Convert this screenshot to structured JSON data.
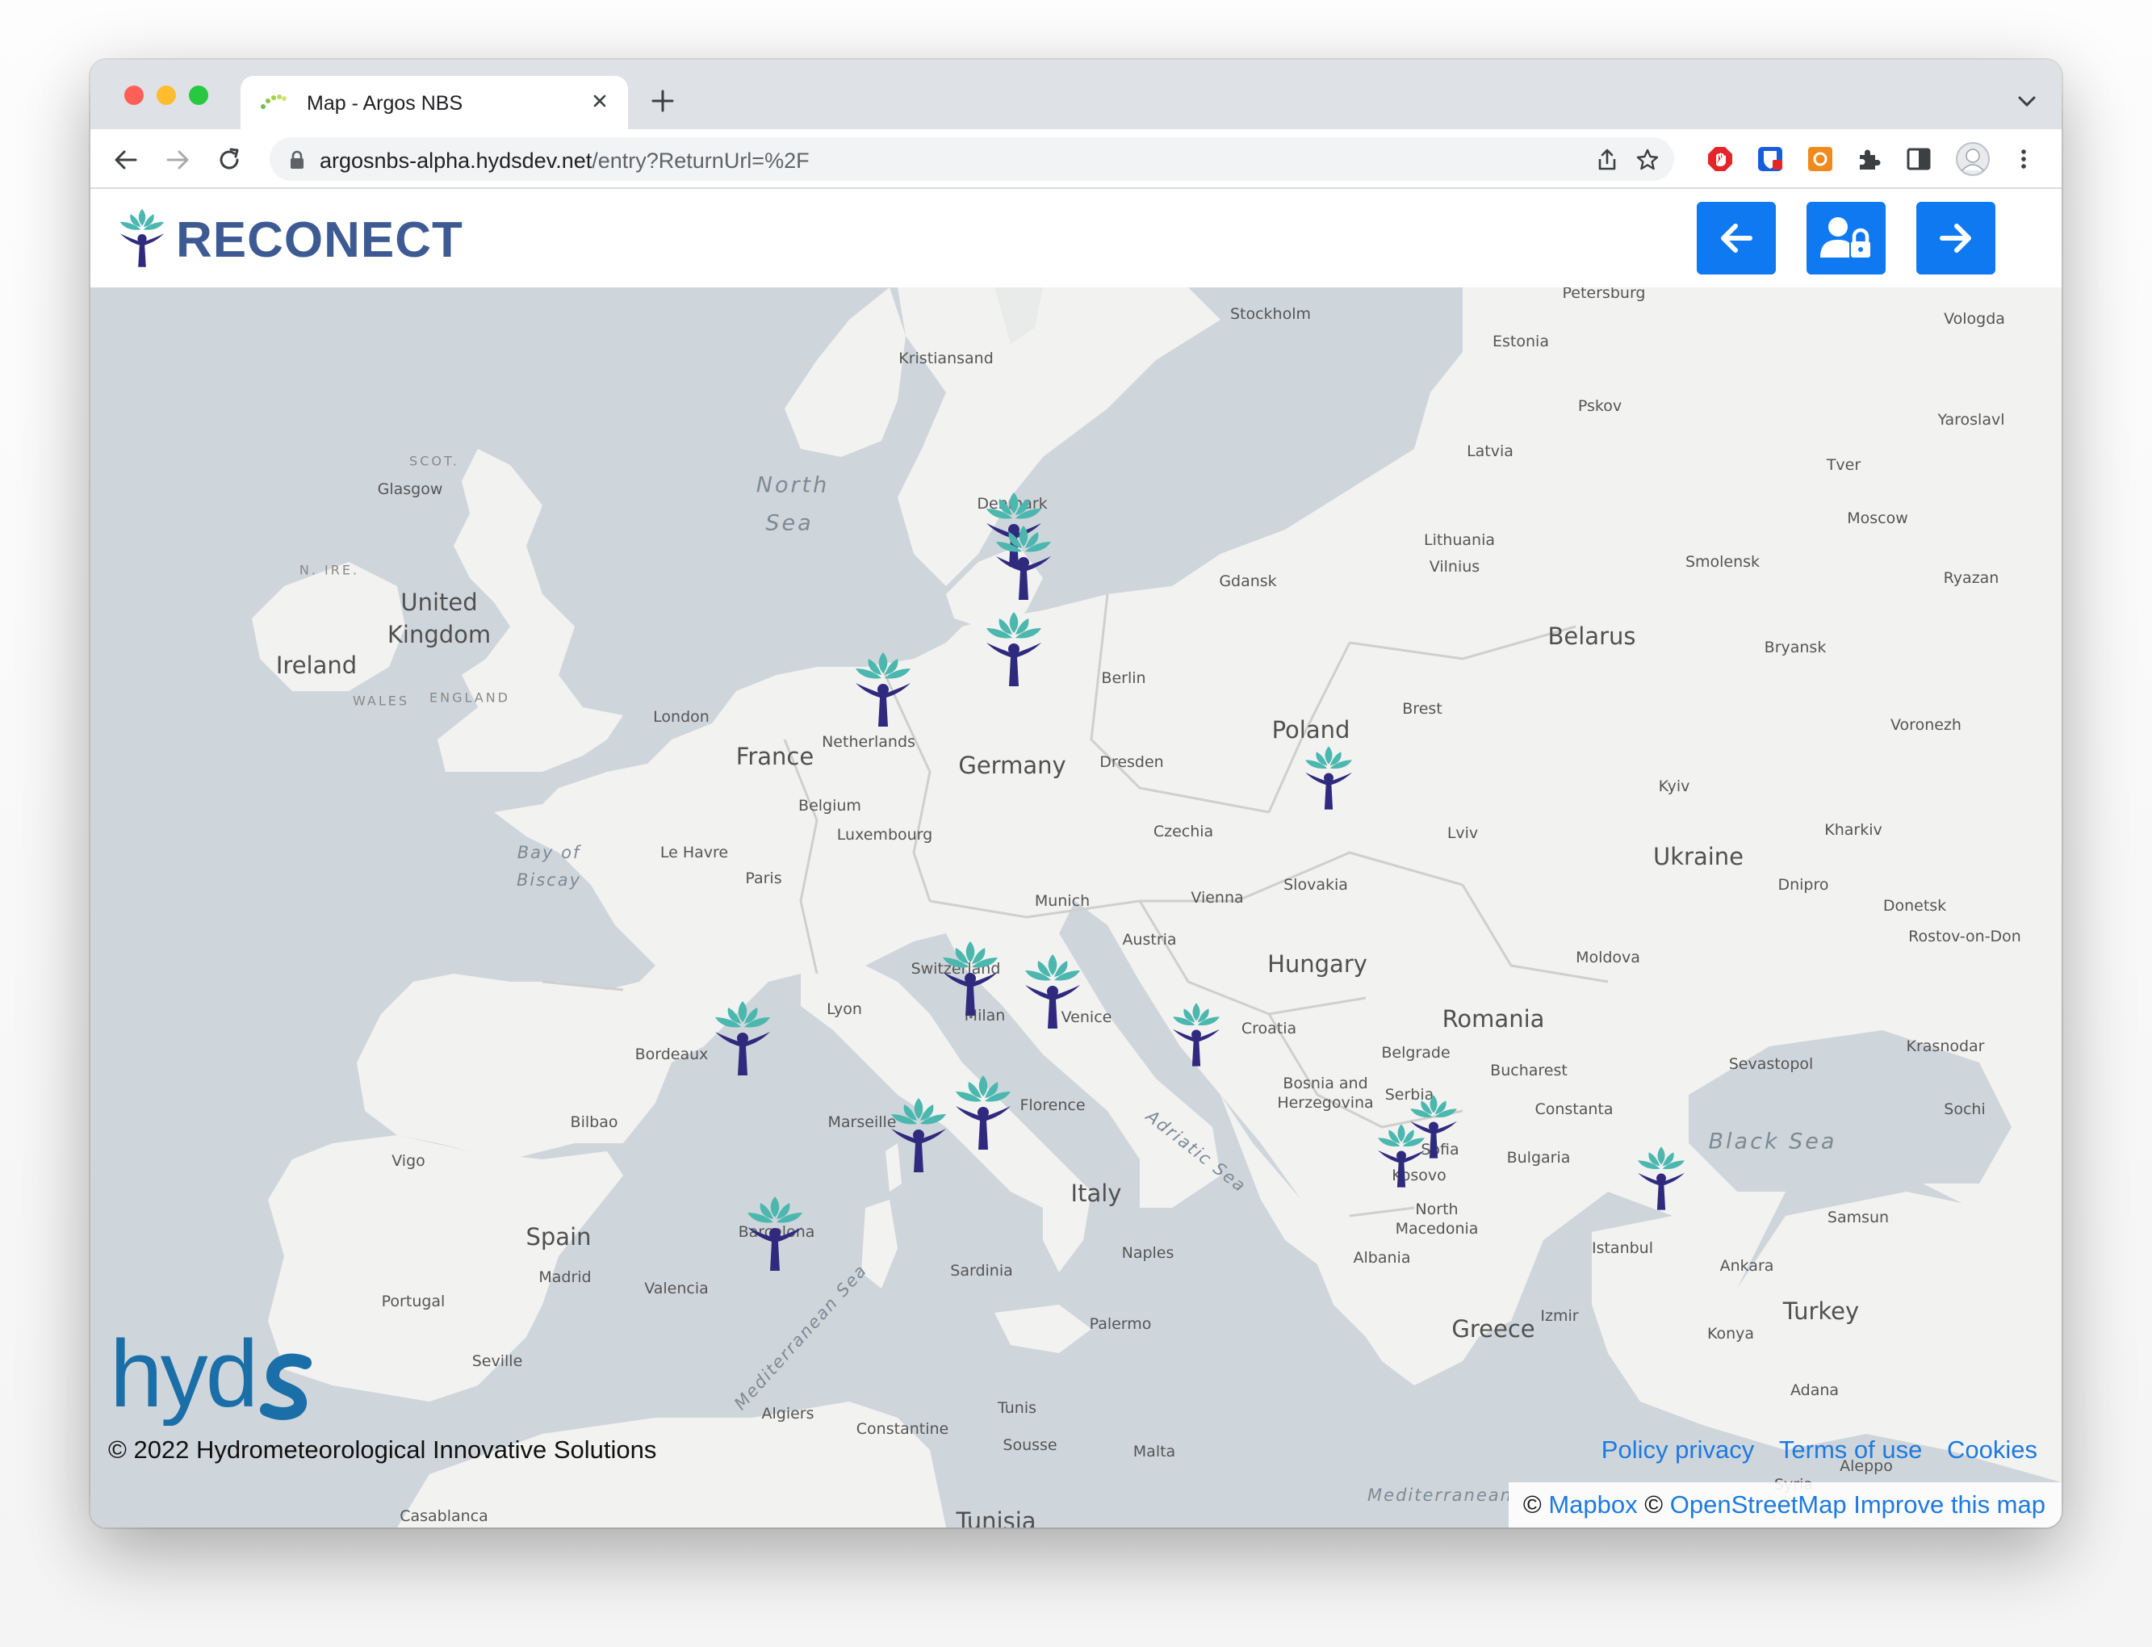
{
  "browser": {
    "tab_title": "Map - Argos NBS",
    "url_host": "argosnbs-alpha.hydsdev.net",
    "url_path": "/entry?ReturnUrl=%2F"
  },
  "header": {
    "logo_text": "RECONECT",
    "buttons": [
      "back-arrow-icon",
      "user-lock-icon",
      "forward-arrow-icon"
    ],
    "accent_color": "#0f79f2",
    "brand_color": "#3d5a92"
  },
  "map": {
    "countries": [
      "Ireland",
      "United Kingdom",
      "France",
      "Spain",
      "Portugal",
      "Germany",
      "Netherlands",
      "Belgium",
      "Luxembourg",
      "Switzerland",
      "Italy",
      "Austria",
      "Czechia",
      "Poland",
      "Slovakia",
      "Hungary",
      "Romania",
      "Bulgaria",
      "Greece",
      "Turkey",
      "Belarus",
      "Ukraine",
      "Lithuania",
      "Latvia",
      "Estonia",
      "Moldova",
      "Croatia",
      "Bosnia and Herzegovina",
      "Serbia",
      "Kosovo",
      "North Macedonia",
      "Albania",
      "Denmark",
      "Tunisia",
      "Malta",
      "Syria"
    ],
    "seas": [
      "North Sea",
      "Bay of Biscay",
      "Black Sea",
      "Adriatic Sea",
      "Mediterranean Sea"
    ],
    "regions": [
      "SCOT.",
      "N. IRE.",
      "WALES",
      "ENGLAND"
    ],
    "cities": [
      "Petersburg",
      "Stockholm",
      "Vologda",
      "Kristiansand",
      "Pskov",
      "Yaroslavl",
      "Glasgow",
      "Tver",
      "Moscow",
      "Gdansk",
      "Vilnius",
      "Smolensk",
      "Ryazan",
      "Bryansk",
      "Berlin",
      "London",
      "Brest",
      "Voronezh",
      "Dresden",
      "Kyiv",
      "Le Havre",
      "Lviv",
      "Kharkiv",
      "Paris",
      "Dnipro",
      "Donetsk",
      "Munich",
      "Vienna",
      "Rostov-on-Don",
      "Lyon",
      "Milan",
      "Venice",
      "Bordeaux",
      "Belgrade",
      "Krasnodar",
      "Bucharest",
      "Sevastopol",
      "Bilbao",
      "Marseille",
      "Florence",
      "Constanta",
      "Sochi",
      "Vigo",
      "Sofia",
      "Samsun",
      "Madrid",
      "Naples",
      "Istanbul",
      "Valencia",
      "Sardinia",
      "Ankara",
      "Barcelona",
      "Izmir",
      "Palermo",
      "Konya",
      "Seville",
      "Adana",
      "Algiers",
      "Tunis",
      "Constantine",
      "Aleppo",
      "Sousse",
      "Casablanca",
      "Mediterranean"
    ],
    "marker_count": 17,
    "marker_colors": {
      "lotus": "#4bb7ae",
      "figure": "#2f2a7e"
    }
  },
  "footer": {
    "brand_logo": "hydus",
    "copyright": "© 2022 Hydrometeorological Innovative Solutions",
    "links": [
      "Policy privacy",
      "Terms of use",
      "Cookies"
    ],
    "attribution_prefix": "©",
    "attribution_mapbox": "Mapbox",
    "attribution_osm": "OpenStreetMap",
    "attribution_improve": "Improve this map"
  }
}
